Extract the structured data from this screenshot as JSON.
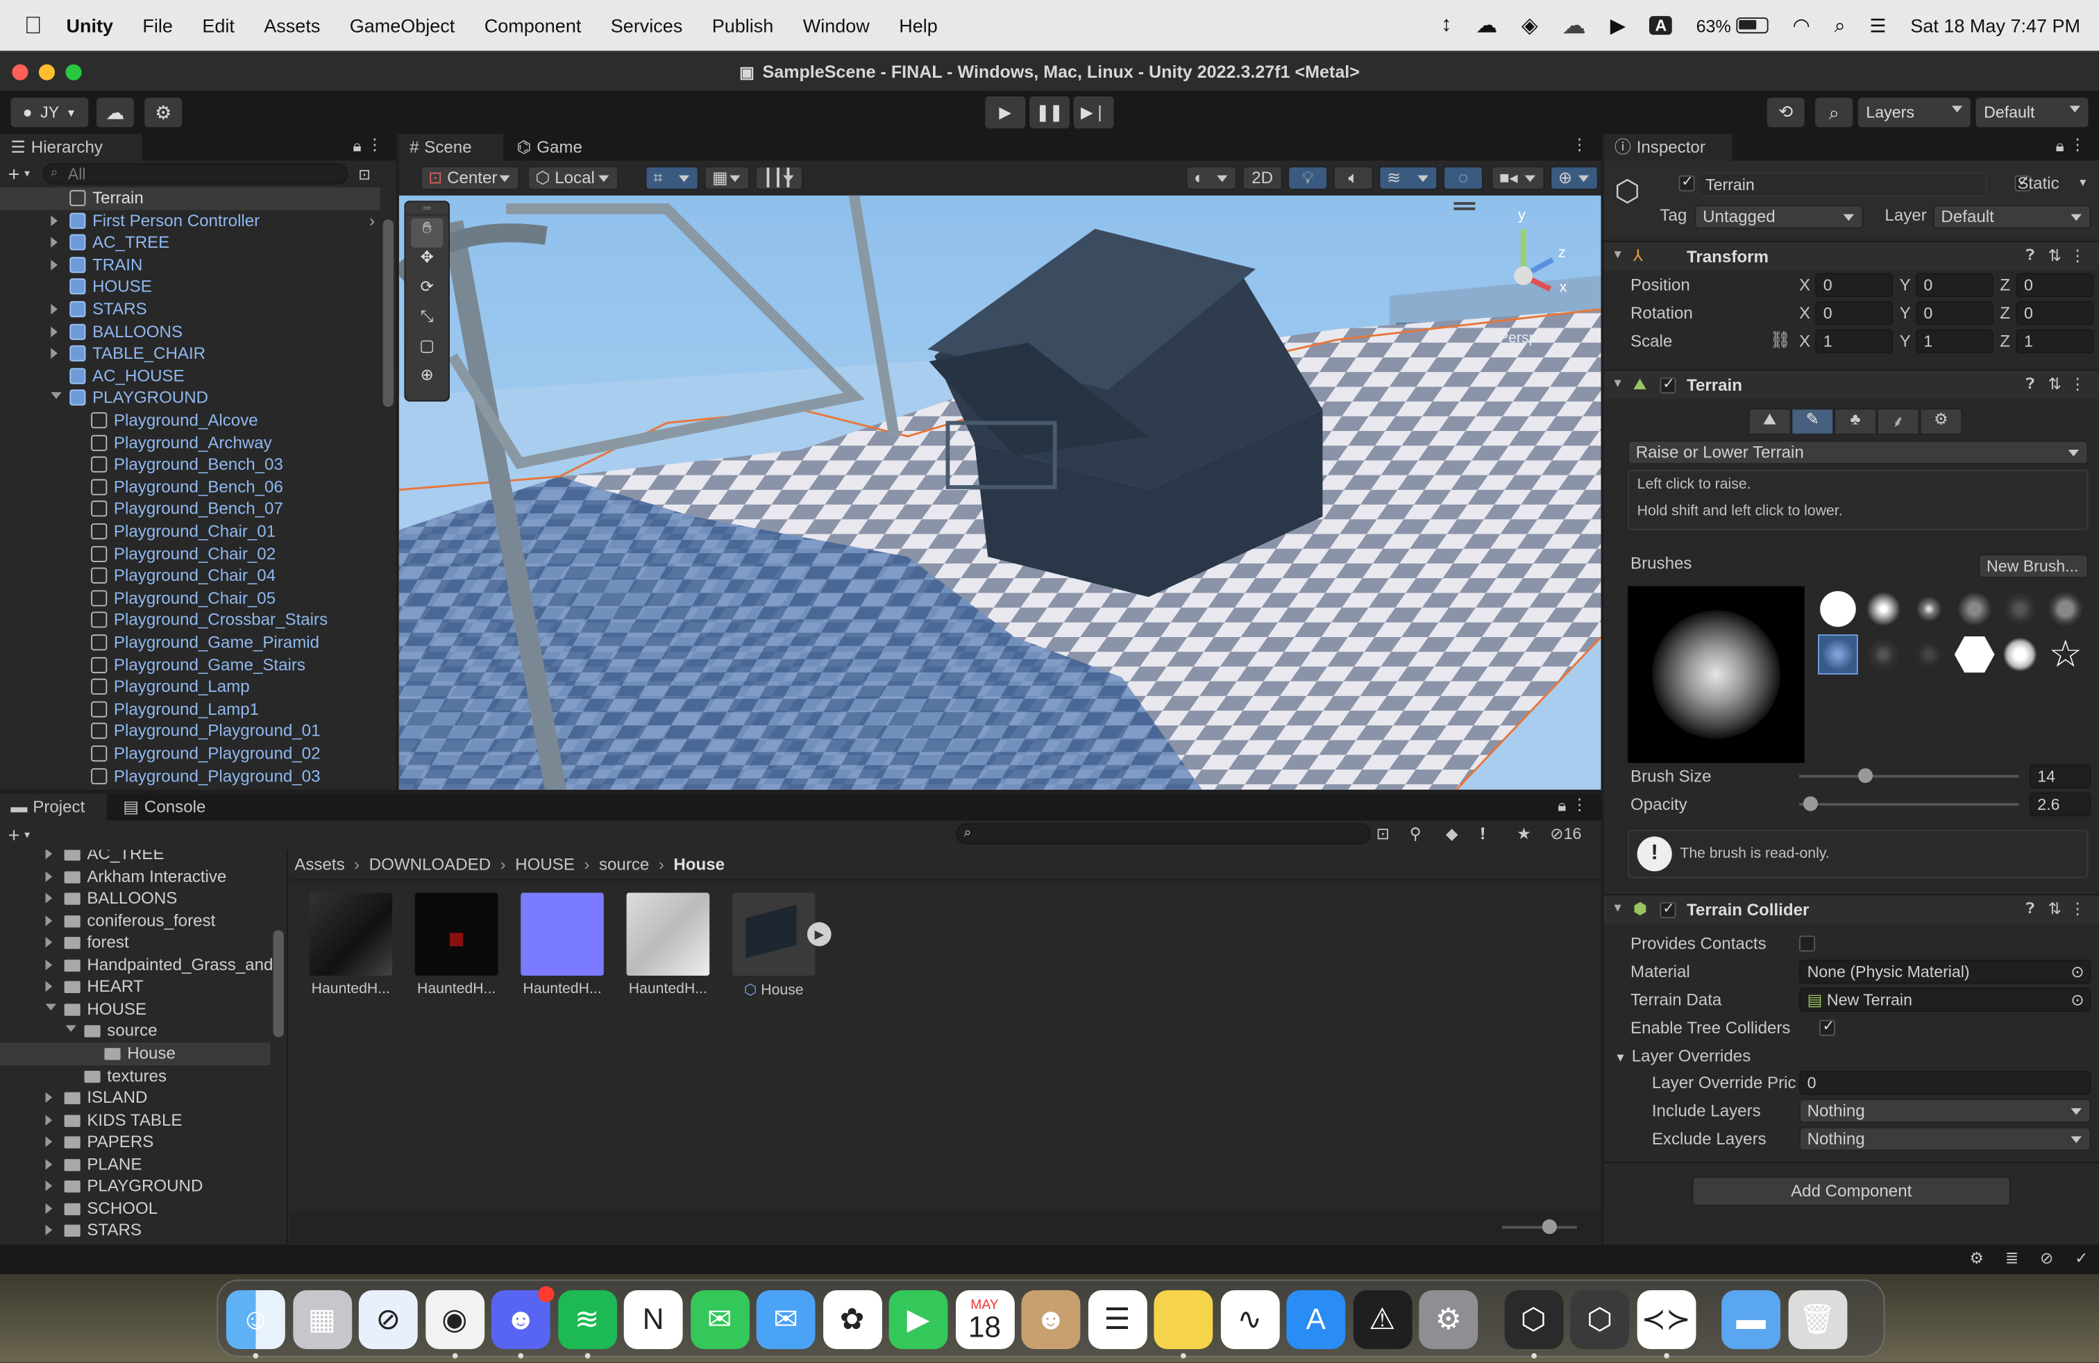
{
  "menubar": {
    "app_name": "Unity",
    "items": [
      "File",
      "Edit",
      "Assets",
      "GameObject",
      "Component",
      "Services",
      "Publish",
      "Window",
      "Help"
    ],
    "battery": "63%",
    "datetime": "Sat 18 May  7:47 PM",
    "keyboard_indicator": "A"
  },
  "window": {
    "title": "SampleScene - FINAL - Windows, Mac, Linux - Unity 2022.3.27f1 <Metal>",
    "account": "JY"
  },
  "toolbar": {
    "layers_label": "Layers",
    "layout_label": "Default"
  },
  "hierarchy": {
    "tab_label": "Hierarchy",
    "search_placeholder": "All",
    "items": [
      {
        "label": "Terrain",
        "depth": 0,
        "expander": "none",
        "icon": "cube-hollow",
        "selected": true
      },
      {
        "label": "First Person Controller",
        "depth": 0,
        "expander": "collapsed",
        "icon": "cube-solid"
      },
      {
        "label": "AC_TREE",
        "depth": 0,
        "expander": "collapsed",
        "icon": "cube-solid"
      },
      {
        "label": "TRAIN",
        "depth": 0,
        "expander": "collapsed",
        "icon": "cube-solid"
      },
      {
        "label": "HOUSE",
        "depth": 0,
        "expander": "none",
        "icon": "cube-solid"
      },
      {
        "label": "STARS",
        "depth": 0,
        "expander": "collapsed",
        "icon": "cube-solid"
      },
      {
        "label": "BALLOONS",
        "depth": 0,
        "expander": "collapsed",
        "icon": "cube-solid"
      },
      {
        "label": "TABLE_CHAIR",
        "depth": 0,
        "expander": "collapsed",
        "icon": "cube-solid"
      },
      {
        "label": "AC_HOUSE",
        "depth": 0,
        "expander": "none",
        "icon": "cube-solid"
      },
      {
        "label": "PLAYGROUND",
        "depth": 0,
        "expander": "expanded",
        "icon": "cube-solid"
      },
      {
        "label": "Playground_Alcove",
        "depth": 1,
        "expander": "none",
        "icon": "cube-hollow"
      },
      {
        "label": "Playground_Archway",
        "depth": 1,
        "expander": "none",
        "icon": "cube-hollow"
      },
      {
        "label": "Playground_Bench_03",
        "depth": 1,
        "expander": "none",
        "icon": "cube-hollow"
      },
      {
        "label": "Playground_Bench_06",
        "depth": 1,
        "expander": "none",
        "icon": "cube-hollow"
      },
      {
        "label": "Playground_Bench_07",
        "depth": 1,
        "expander": "none",
        "icon": "cube-hollow"
      },
      {
        "label": "Playground_Chair_01",
        "depth": 1,
        "expander": "none",
        "icon": "cube-hollow"
      },
      {
        "label": "Playground_Chair_02",
        "depth": 1,
        "expander": "none",
        "icon": "cube-hollow"
      },
      {
        "label": "Playground_Chair_04",
        "depth": 1,
        "expander": "none",
        "icon": "cube-hollow"
      },
      {
        "label": "Playground_Chair_05",
        "depth": 1,
        "expander": "none",
        "icon": "cube-hollow"
      },
      {
        "label": "Playground_Crossbar_Stairs",
        "depth": 1,
        "expander": "none",
        "icon": "cube-hollow"
      },
      {
        "label": "Playground_Game_Piramid",
        "depth": 1,
        "expander": "none",
        "icon": "cube-hollow"
      },
      {
        "label": "Playground_Game_Stairs",
        "depth": 1,
        "expander": "none",
        "icon": "cube-hollow"
      },
      {
        "label": "Playground_Lamp",
        "depth": 1,
        "expander": "none",
        "icon": "cube-hollow"
      },
      {
        "label": "Playground_Lamp1",
        "depth": 1,
        "expander": "none",
        "icon": "cube-hollow"
      },
      {
        "label": "Playground_Playground_01",
        "depth": 1,
        "expander": "none",
        "icon": "cube-hollow"
      },
      {
        "label": "Playground_Playground_02",
        "depth": 1,
        "expander": "none",
        "icon": "cube-hollow"
      },
      {
        "label": "Playground_Playground_03",
        "depth": 1,
        "expander": "none",
        "icon": "cube-hollow"
      }
    ]
  },
  "scene": {
    "tabs": [
      "Scene",
      "Game"
    ],
    "pivot_mode": "Center",
    "pivot_rotation": "Local",
    "mode_2d": "2D",
    "gizmo_label": "< Persp",
    "axis_y": "y",
    "axis_x": "x",
    "axis_z": "z"
  },
  "project": {
    "tabs": [
      "Project",
      "Console"
    ],
    "hidden_count": "16",
    "folders": [
      {
        "label": "AC_TREE",
        "depth": 0,
        "expander": "collapsed"
      },
      {
        "label": "Arkham Interactive",
        "depth": 0,
        "expander": "collapsed"
      },
      {
        "label": "BALLOONS",
        "depth": 0,
        "expander": "collapsed"
      },
      {
        "label": "coniferous_forest",
        "depth": 0,
        "expander": "collapsed"
      },
      {
        "label": "forest",
        "depth": 0,
        "expander": "collapsed"
      },
      {
        "label": "Handpainted_Grass_and",
        "depth": 0,
        "expander": "collapsed"
      },
      {
        "label": "HEART",
        "depth": 0,
        "expander": "collapsed"
      },
      {
        "label": "HOUSE",
        "depth": 0,
        "expander": "expanded"
      },
      {
        "label": "source",
        "depth": 1,
        "expander": "expanded"
      },
      {
        "label": "House",
        "depth": 2,
        "expander": "none",
        "selected": true
      },
      {
        "label": "textures",
        "depth": 1,
        "expander": "none"
      },
      {
        "label": "ISLAND",
        "depth": 0,
        "expander": "collapsed"
      },
      {
        "label": "KIDS TABLE",
        "depth": 0,
        "expander": "collapsed"
      },
      {
        "label": "PAPERS",
        "depth": 0,
        "expander": "collapsed"
      },
      {
        "label": "PLANE",
        "depth": 0,
        "expander": "collapsed"
      },
      {
        "label": "PLAYGROUND",
        "depth": 0,
        "expander": "collapsed"
      },
      {
        "label": "SCHOOL",
        "depth": 0,
        "expander": "collapsed"
      },
      {
        "label": "STARS",
        "depth": 0,
        "expander": "collapsed"
      }
    ],
    "breadcrumb": [
      "Assets",
      "DOWNLOADED",
      "HOUSE",
      "source",
      "House"
    ],
    "assets": [
      {
        "label": "HauntedH...",
        "kind": "texture-dark"
      },
      {
        "label": "HauntedH...",
        "kind": "texture-black"
      },
      {
        "label": "HauntedH...",
        "kind": "texture-normal"
      },
      {
        "label": "HauntedH...",
        "kind": "texture-light"
      },
      {
        "label": "House",
        "kind": "model"
      }
    ]
  },
  "inspector": {
    "tab_label": "Inspector",
    "object_name": "Terrain",
    "static_label": "Static",
    "tag_label": "Tag",
    "tag_value": "Untagged",
    "layer_label": "Layer",
    "layer_value": "Default",
    "transform": {
      "header": "Transform",
      "rows": [
        {
          "label": "Position",
          "x": "0",
          "y": "0",
          "z": "0"
        },
        {
          "label": "Rotation",
          "x": "0",
          "y": "0",
          "z": "0"
        },
        {
          "label": "Scale",
          "x": "1",
          "y": "1",
          "z": "1"
        }
      ],
      "axis_x": "X",
      "axis_y": "Y",
      "axis_z": "Z"
    },
    "terrain": {
      "header": "Terrain",
      "tool_dropdown": "Raise or Lower Terrain",
      "help_line1": "Left click to raise.",
      "help_line2": "Hold shift and left click to lower.",
      "brushes_label": "Brushes",
      "new_brush_button": "New Brush...",
      "brush_size_label": "Brush Size",
      "brush_size_value": "14",
      "brush_size_fraction": 0.3,
      "opacity_label": "Opacity",
      "opacity_value": "2.6",
      "opacity_fraction": 0.05,
      "readonly_message": "The brush is read-only."
    },
    "collider": {
      "header": "Terrain Collider",
      "provides_contacts_label": "Provides Contacts",
      "material_label": "Material",
      "material_value": "None (Physic Material)",
      "terrain_data_label": "Terrain Data",
      "terrain_data_value": "New Terrain",
      "enable_tree_label": "Enable Tree Colliders",
      "layer_overrides_label": "Layer Overrides",
      "priority_label": "Layer Override Pric",
      "priority_value": "0",
      "include_label": "Include Layers",
      "include_value": "Nothing",
      "exclude_label": "Exclude Layers",
      "exclude_value": "Nothing"
    },
    "add_component_button": "Add Component"
  },
  "dock": {
    "calendar_month": "MAY",
    "calendar_day": "18",
    "apps": [
      "finder",
      "launchpad",
      "safari",
      "chrome",
      "discord",
      "spotify",
      "notion",
      "messages",
      "mail",
      "photos",
      "facetime",
      "calendar",
      "contacts",
      "reminders",
      "notes",
      "freeform",
      "app-store",
      "instruments",
      "system-settings",
      "unity-hub",
      "unity",
      "vscode",
      "downloads",
      "trash"
    ]
  },
  "colors": {
    "accent_blue": "#2c5d87",
    "hierarchy_text": "#8fb8f0",
    "sky": "#9cc7ee",
    "selection_outline": "#e8763a"
  }
}
